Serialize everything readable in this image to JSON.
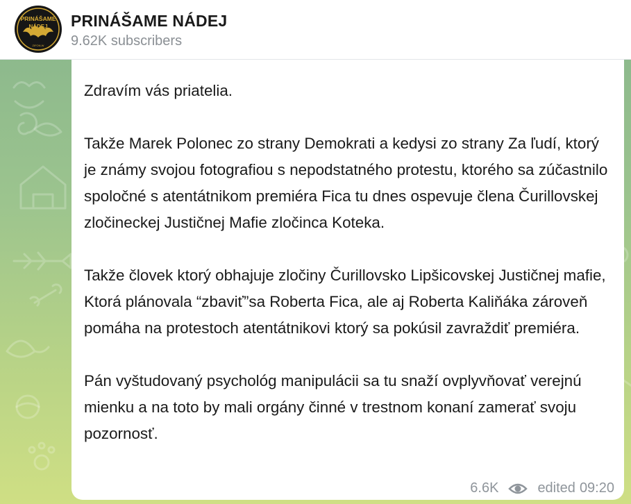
{
  "channel": {
    "title": "PRINÁŠAME NÁDEJ",
    "subscribers": "9.62K subscribers",
    "avatar_text_top": "PRINÁŠAME",
    "avatar_text_bottom": "NÁDEJ",
    "avatar_small": "ZIFON.W"
  },
  "message": {
    "paragraphs": [
      "Zdravím vás priatelia.",
      "Takže Marek Polonec zo strany Demokrati a kedysi zo strany Za ľudí, ktorý je známy svojou fotografiou s nepodstatného protestu, ktorého sa zúčastnilo spoločné s atentátnikom premiéra Fica tu dnes ospevuje člena Čurillovskej zločineckej Justičnej Mafie zločinca Koteka.",
      "Takže človek ktorý obhajuje zločiny Čurillovsko Lipšicovskej Justičnej mafie, Ktorá plánovala “zbaviť”sa Roberta Fica, ale aj Roberta Kaliňáka zároveň pomáha na protestoch atentátnikovi ktorý sa pokúsil zavraždiť premiéra.",
      "Pán vyštudovaný psychológ manipulácii sa tu snaží ovplyvňovať verejnú mienku a na toto by mali orgány činné v trestnom konaní zamerať svoju pozornosť."
    ],
    "views": "6.6K",
    "edited_label": "edited",
    "time": "09:20"
  },
  "colors": {
    "wallpaper_top": "#87b58c",
    "wallpaper_bottom": "#cfdf84",
    "avatar_gold": "#d4a934"
  }
}
